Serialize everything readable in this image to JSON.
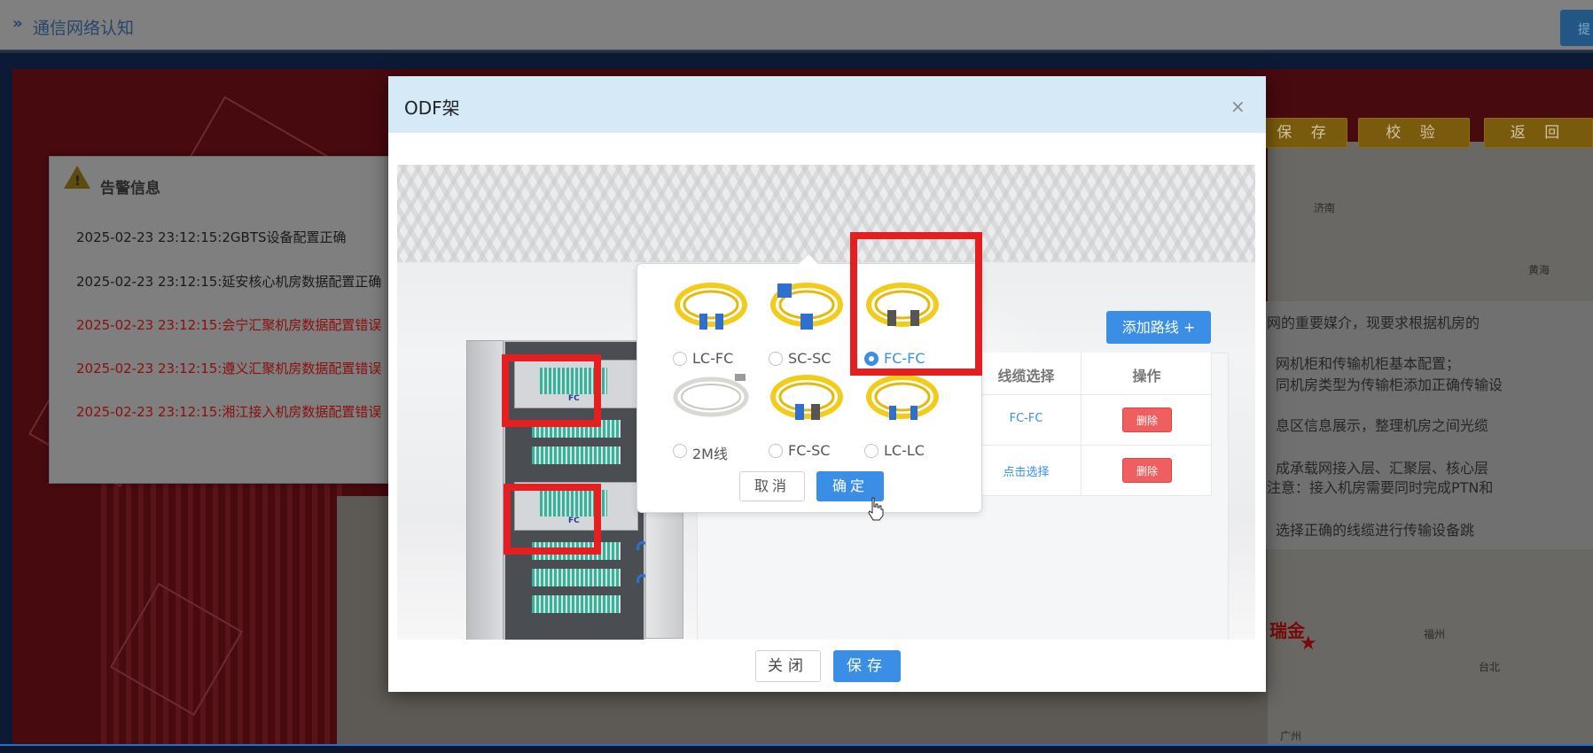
{
  "header": {
    "title": "通信网络认知",
    "right_button": "提"
  },
  "top_buttons": [
    "保 存",
    "校 验",
    "返 回"
  ],
  "alarm": {
    "title": "告警信息",
    "logs": [
      {
        "text": "2025-02-23 23:12:15:2GBTS设备配置正确",
        "level": "ok"
      },
      {
        "text": "2025-02-23 23:12:15:延安核心机房数据配置正确",
        "level": "ok"
      },
      {
        "text": "2025-02-23 23:12:15:会宁汇聚机房数据配置错误",
        "level": "error"
      },
      {
        "text": "2025-02-23 23:12:15:遵义汇聚机房数据配置错误",
        "level": "error"
      },
      {
        "text": "2025-02-23 23:12:15:湘江接入机房数据配置错误",
        "level": "error"
      }
    ]
  },
  "task_panel": {
    "lines": [
      "网的重要媒介，现要求根据机房的",
      "网机柜和传输机柜基本配置；",
      "同机房类型为传输柜添加正确传输设",
      "息区信息展示，整理机房之间光缆",
      "成承载网接入层、汇聚层、核心层",
      "注意：接入机房需要同时完成PTN和",
      "选择正确的线缆进行传输设备跳"
    ]
  },
  "map_labels": {
    "jinan": "济南",
    "fuzhou": "福州",
    "taibei": "台北",
    "guangzhou": "广州",
    "shandong": "黄海",
    "ruijin": "瑞金"
  },
  "modal": {
    "title": "ODF架",
    "close_icon": "×",
    "add_route_label": "添加路线 +",
    "table": {
      "headers": [
        "线缆选择",
        "操作"
      ],
      "rows": [
        {
          "cable": "FC-FC",
          "action": "删除"
        },
        {
          "cable": "点击选择",
          "action": "删除"
        }
      ]
    },
    "cabinet_port_label": "FC",
    "popover": {
      "options": [
        {
          "label": "LC-FC",
          "selected": false,
          "cable_color": "#f1cc1a",
          "end_color": "#2f6fd0"
        },
        {
          "label": "SC-SC",
          "selected": false,
          "cable_color": "#f1cc1a",
          "end_color": "#2f6fd0"
        },
        {
          "label": "FC-FC",
          "selected": true,
          "cable_color": "#f1cc1a",
          "end_color": "#555555"
        },
        {
          "label": "2M线",
          "selected": false,
          "cable_color": "#d9d9d4",
          "end_color": "#9a9a9a"
        },
        {
          "label": "FC-SC",
          "selected": false,
          "cable_color": "#f1cc1a",
          "end_color": "#2f6fd0"
        },
        {
          "label": "LC-LC",
          "selected": false,
          "cable_color": "#f1cc1a",
          "end_color": "#2f6fd0"
        }
      ],
      "cancel_label": "取消",
      "confirm_label": "确定"
    },
    "footer": {
      "close_label": "关闭",
      "save_label": "保存"
    }
  },
  "colors": {
    "primary": "#3a8ee6",
    "danger": "#ef5f5f",
    "highlight": "#e41f21"
  }
}
